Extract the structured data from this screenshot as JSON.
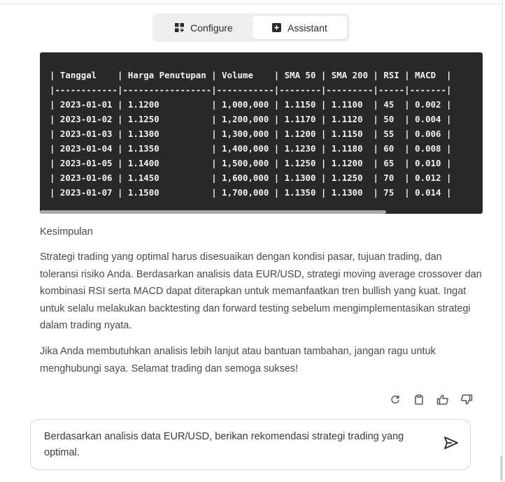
{
  "tabs": [
    {
      "label": "Configure",
      "icon": "grid-plus-icon"
    },
    {
      "label": "Assistant",
      "icon": "sparkle-icon"
    }
  ],
  "code_block": {
    "lines": [
      "| Tanggal    | Harga Penutupan | Volume    | SMA 50 | SMA 200 | RSI | MACD  |",
      "|------------|-----------------|-----------|--------|---------|-----|-------|",
      "| 2023-01-01 | 1.1200          | 1,000,000 | 1.1150 | 1.1100  | 45  | 0.002 |",
      "| 2023-01-02 | 1.1250          | 1,200,000 | 1.1170 | 1.1120  | 50  | 0.004 |",
      "| 2023-01-03 | 1.1300          | 1,300,000 | 1.1200 | 1.1150  | 55  | 0.006 |",
      "| 2023-01-04 | 1.1350          | 1,400,000 | 1.1230 | 1.1180  | 60  | 0.008 |",
      "| 2023-01-05 | 1.1400          | 1,500,000 | 1.1250 | 1.1200  | 65  | 0.010 |",
      "| 2023-01-06 | 1.1450          | 1,600,000 | 1.1300 | 1.1250  | 70  | 0.012 |",
      "| 2023-01-07 | 1.1500          | 1,700,000 | 1.1350 | 1.1300  | 75  | 0.014 |"
    ]
  },
  "message": {
    "section_title": "Kesimpulan",
    "paragraph1": "Strategi trading yang optimal harus disesuaikan dengan kondisi pasar, tujuan trading, dan toleransi risiko Anda. Berdasarkan analisis data EUR/USD, strategi moving average crossover dan kombinasi RSI serta MACD dapat diterapkan untuk memanfaatkan tren bullish yang kuat. Ingat untuk selalu melakukan backtesting dan forward testing sebelum mengimplementasikan strategi dalam trading nyata.",
    "paragraph2": "Jika Anda membutuhkan analisis lebih lanjut atau bantuan tambahan, jangan ragu untuk menghubungi saya. Selamat trading dan semoga sukses!"
  },
  "actions": [
    {
      "name": "regenerate-icon"
    },
    {
      "name": "copy-icon"
    },
    {
      "name": "thumbs-up-icon"
    },
    {
      "name": "thumbs-down-icon"
    }
  ],
  "input": {
    "value": "Berdasarkan analisis data EUR/USD, berikan rekomendasi strategi trading yang optimal.",
    "send_icon": "send-icon"
  },
  "colors": {
    "code_bg": "#282826",
    "tab_bar_bg": "#efefef",
    "text": "#4a4a4a"
  }
}
